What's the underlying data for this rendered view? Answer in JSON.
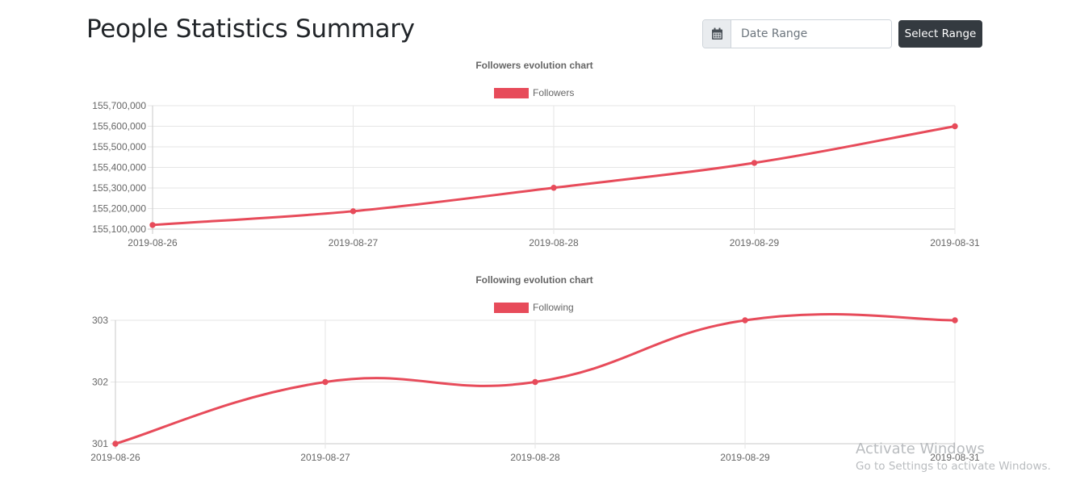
{
  "header": {
    "title": "People Statistics Summary",
    "date_range_placeholder": "Date Range",
    "calendar_icon": "calendar-icon",
    "select_range_label": "Select Range",
    "button_color": "#343a40"
  },
  "watermark": {
    "line1": "Activate Windows",
    "line2": "Go to Settings to activate Windows."
  },
  "chart_data": [
    {
      "type": "line",
      "title": "Followers evolution chart",
      "categories": [
        "2019-08-26",
        "2019-08-27",
        "2019-08-28",
        "2019-08-29",
        "2019-08-31"
      ],
      "series": [
        {
          "name": "Followers",
          "values": [
            155120000,
            155187000,
            155301000,
            155422000,
            155600000
          ],
          "color": "#e74b5a"
        }
      ],
      "ylim": [
        155100000,
        155700000
      ],
      "yticks": [
        155100000,
        155200000,
        155300000,
        155400000,
        155500000,
        155600000,
        155700000
      ],
      "ytick_labels": [
        "155,100,000",
        "155,200,000",
        "155,300,000",
        "155,400,000",
        "155,500,000",
        "155,600,000",
        "155,700,000"
      ],
      "grid": true,
      "legend": "top-center",
      "xlabel": "",
      "ylabel": ""
    },
    {
      "type": "line",
      "title": "Following evolution chart",
      "categories": [
        "2019-08-26",
        "2019-08-27",
        "2019-08-28",
        "2019-08-29",
        "2019-08-31"
      ],
      "series": [
        {
          "name": "Following",
          "values": [
            301,
            302,
            302,
            303,
            303
          ],
          "color": "#e74b5a"
        }
      ],
      "ylim": [
        301,
        303
      ],
      "yticks": [
        301,
        302,
        303
      ],
      "ytick_labels": [
        "301",
        "302",
        "303"
      ],
      "grid": true,
      "legend": "top-center",
      "xlabel": "",
      "ylabel": ""
    }
  ]
}
